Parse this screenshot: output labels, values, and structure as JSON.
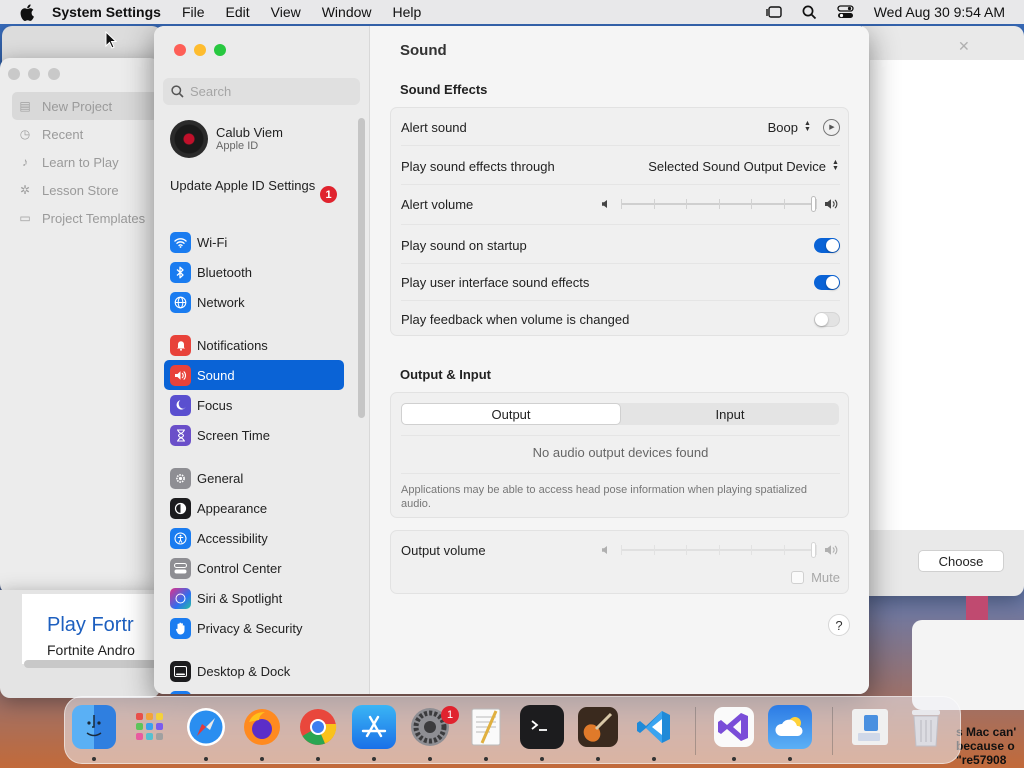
{
  "menubar": {
    "app_name": "System Settings",
    "menus": [
      "File",
      "Edit",
      "View",
      "Window",
      "Help"
    ],
    "clock": "Wed Aug 30  9:54 AM"
  },
  "background_window": {
    "sidebar": [
      "New Project",
      "Recent",
      "Learn to Play",
      "Lesson Store",
      "Project Templates"
    ],
    "promo_title": "Play Fortr",
    "promo_sub": "Fortnite Andro",
    "choose_label": "Choose",
    "notification_text": [
      "s Mac can'",
      "because o",
      "\"re57908"
    ]
  },
  "settings": {
    "search_placeholder": "Search",
    "account": {
      "name": "Calub Viem",
      "sub": "Apple ID"
    },
    "update": {
      "label": "Update Apple ID Settings",
      "badge": "1"
    },
    "nav": [
      {
        "label": "Wi-Fi",
        "icon": "wifi-icon",
        "color": "#1a7cf0"
      },
      {
        "label": "Bluetooth",
        "icon": "bluetooth-icon",
        "color": "#1a7cf0"
      },
      {
        "label": "Network",
        "icon": "globe-icon",
        "color": "#1a7cf0"
      },
      {
        "label": "Notifications",
        "icon": "bell-icon",
        "color": "#e8423a"
      },
      {
        "label": "Sound",
        "icon": "speaker-icon",
        "color": "#e8423a"
      },
      {
        "label": "Focus",
        "icon": "moon-icon",
        "color": "#5a4fcf"
      },
      {
        "label": "Screen Time",
        "icon": "hourglass-icon",
        "color": "#6a4fc9"
      },
      {
        "label": "General",
        "icon": "gear-icon",
        "color": "#8e8e93"
      },
      {
        "label": "Appearance",
        "icon": "appearance-icon",
        "color": "#1c1c1e"
      },
      {
        "label": "Accessibility",
        "icon": "accessibility-icon",
        "color": "#1a7cf0"
      },
      {
        "label": "Control Center",
        "icon": "control-center-icon",
        "color": "#8e8e93"
      },
      {
        "label": "Siri & Spotlight",
        "icon": "siri-icon",
        "color": "#7a3fd0"
      },
      {
        "label": "Privacy & Security",
        "icon": "hand-icon",
        "color": "#1a7cf0"
      },
      {
        "label": "Desktop & Dock",
        "icon": "dock-icon",
        "color": "#1c1c1e"
      }
    ],
    "selected": "Sound",
    "page_title": "Sound",
    "sound_effects": {
      "title": "Sound Effects",
      "alert_sound_label": "Alert sound",
      "alert_sound_value": "Boop",
      "play_through_label": "Play sound effects through",
      "play_through_value": "Selected Sound Output Device",
      "alert_volume_label": "Alert volume",
      "alert_volume_level": 1.0,
      "startup_label": "Play sound on startup",
      "startup_on": true,
      "ui_sounds_label": "Play user interface sound effects",
      "ui_sounds_on": true,
      "feedback_label": "Play feedback when volume is changed",
      "feedback_on": false
    },
    "output_input": {
      "title": "Output & Input",
      "tab_output": "Output",
      "tab_input": "Input",
      "active_tab": "Output",
      "empty_message": "No audio output devices found",
      "note": "Applications may be able to access head pose information when playing spatialized audio.",
      "output_volume_label": "Output volume",
      "output_volume_level": 1.0,
      "mute_label": "Mute"
    },
    "help": "?"
  },
  "dock": {
    "apps": [
      "Finder",
      "Launchpad",
      "Safari",
      "Firefox",
      "Chrome",
      "App Store",
      "System Settings",
      "TextEdit",
      "Terminal",
      "GarageBand",
      "Visual Studio Code",
      "Visual Studio",
      "Weather",
      "Finder Window",
      "Trash"
    ],
    "settings_badge": "1"
  }
}
